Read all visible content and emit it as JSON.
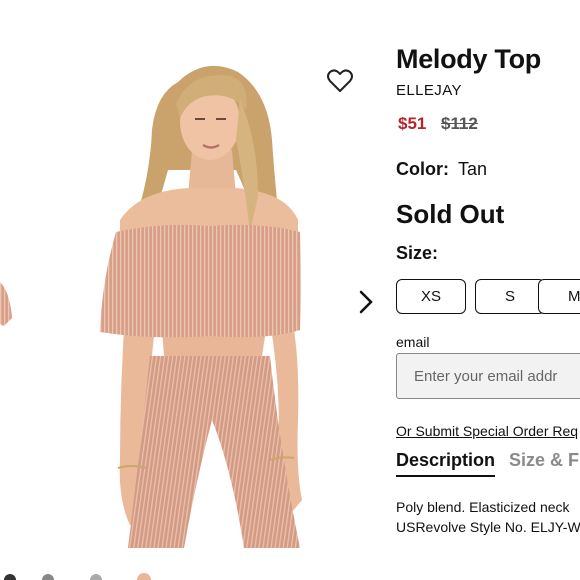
{
  "product": {
    "title": "Melody Top",
    "brand": "ELLEJAY",
    "sale_price": "$51",
    "original_price": "$112",
    "color_label": "Color:",
    "color_value": "Tan",
    "status": "Sold Out",
    "size_label": "Size:",
    "sizes": [
      "XS",
      "S",
      "M"
    ]
  },
  "notify": {
    "email_label": "email",
    "email_placeholder": "Enter your email addr",
    "special_order_link": "Or Submit Special Order Req"
  },
  "tabs": [
    {
      "label": "Description",
      "active": true
    },
    {
      "label": "Size & Fi",
      "active": false
    }
  ],
  "description": {
    "line1": "Poly blend. Elasticized neck",
    "line2": "USRevolve Style No. ELJY-W"
  },
  "icons": {
    "wishlist": "heart-outline-icon",
    "next": "chevron-right-icon"
  },
  "colors": {
    "sale_price": "#b3262d",
    "garment": "#d9a08a",
    "inactive_tab": "#8a8a8a"
  }
}
